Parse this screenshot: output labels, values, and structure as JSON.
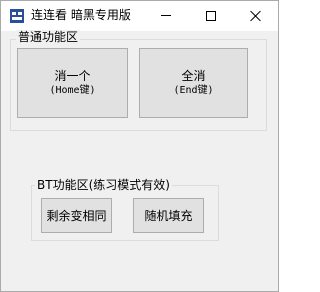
{
  "window": {
    "title": "连连看 暗黑专用版"
  },
  "titlebar_buttons": {
    "minimize": "minimize",
    "maximize": "maximize",
    "close": "close"
  },
  "group_normal": {
    "legend": "普通功能区",
    "buttons": [
      {
        "line1": "消一个",
        "line2": "(Home键)"
      },
      {
        "line1": "全消",
        "line2": "(End键)"
      }
    ]
  },
  "group_bt": {
    "legend": "BT功能区(练习模式有效)",
    "buttons": [
      {
        "label": "剩余变相同"
      },
      {
        "label": "随机填充"
      }
    ]
  },
  "colors": {
    "app_icon_bg": "#2b4e9b",
    "button_face": "#e1e1e1",
    "window_bg": "#f0f0f0"
  }
}
